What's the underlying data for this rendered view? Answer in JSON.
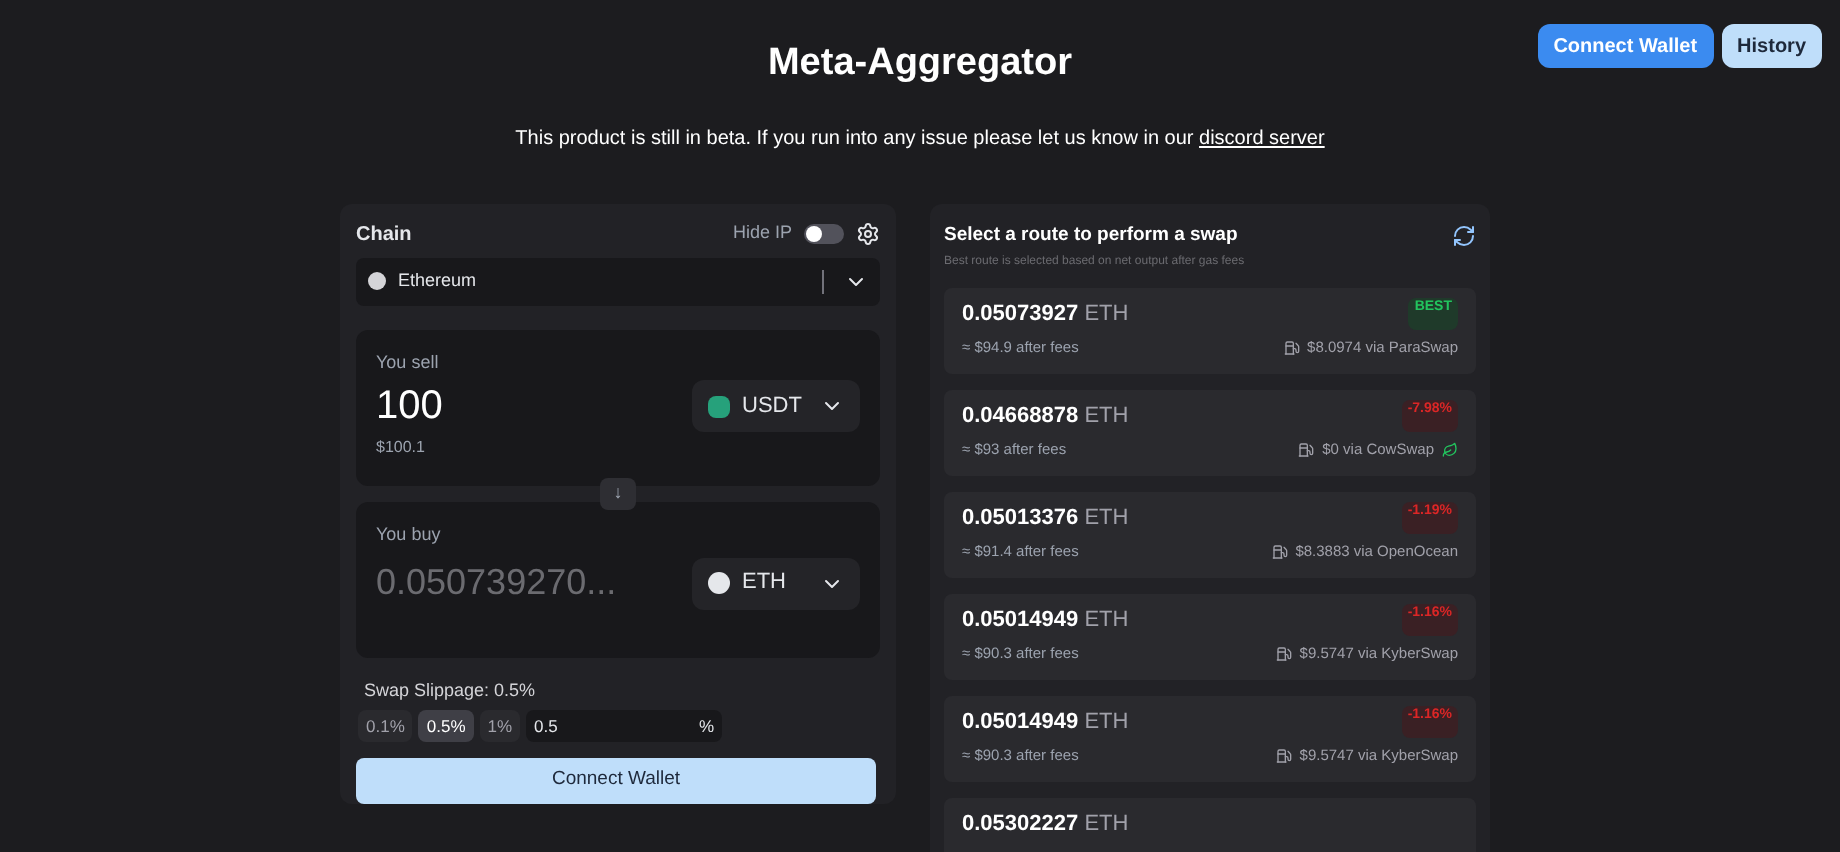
{
  "title": "Meta-Aggregator",
  "header_buttons": [
    {
      "label": "Connect Wallet",
      "kind": "primary"
    },
    {
      "label": "History",
      "kind": "secondary"
    }
  ],
  "notice": {
    "text": "This product is still in beta. If you run into any issue please let us know in our",
    "link": "discord server"
  },
  "swap": {
    "chain_label": "Chain",
    "hide_ip": {
      "label": "Hide IP",
      "on": false
    },
    "chain": "Ethereum",
    "sell": {
      "label": "You sell",
      "amount": "100",
      "usd": "$100.1",
      "token": "USDT"
    },
    "switch_icon": "↓",
    "buy": {
      "label": "You buy",
      "amount": "0.050739270...",
      "token": "ETH"
    },
    "slippage": {
      "label": "Swap Slippage: 0.5%",
      "options": [
        {
          "label": "0.1%",
          "selected": false
        },
        {
          "label": "0.5%",
          "selected": true
        },
        {
          "label": "1%",
          "selected": false
        }
      ],
      "value": "0.5",
      "unit": "%"
    },
    "connect_button": "Connect Wallet"
  },
  "routes": {
    "title": "Select a route to perform a swap",
    "subtitle": "Best route is selected based on net output after gas fees",
    "items": [
      {
        "amount": "0.05073927",
        "unit": "ETH",
        "after_fees": "≈ $94.9 after fees",
        "badge": "BEST",
        "best": true,
        "route": "$8.0974 via ParaSwap",
        "extra_icon": false
      },
      {
        "amount": "0.04668878",
        "unit": "ETH",
        "after_fees": "≈ $93 after fees",
        "badge": "-7.98%",
        "best": false,
        "route": "$0 via CowSwap",
        "extra_icon": true
      },
      {
        "amount": "0.05013376",
        "unit": "ETH",
        "after_fees": "≈ $91.4 after fees",
        "badge": "-1.19%",
        "best": false,
        "route": "$8.3883 via OpenOcean",
        "extra_icon": false
      },
      {
        "amount": "0.05014949",
        "unit": "ETH",
        "after_fees": "≈ $90.3 after fees",
        "badge": "-1.16%",
        "best": false,
        "route": "$9.5747 via KyberSwap",
        "extra_icon": false
      },
      {
        "amount": "0.05014949",
        "unit": "ETH",
        "after_fees": "≈ $90.3 after fees",
        "badge": "-1.16%",
        "best": false,
        "route": "$9.5747 via KyberSwap",
        "extra_icon": false
      },
      {
        "amount": "0.05302227",
        "unit": "ETH"
      }
    ]
  }
}
